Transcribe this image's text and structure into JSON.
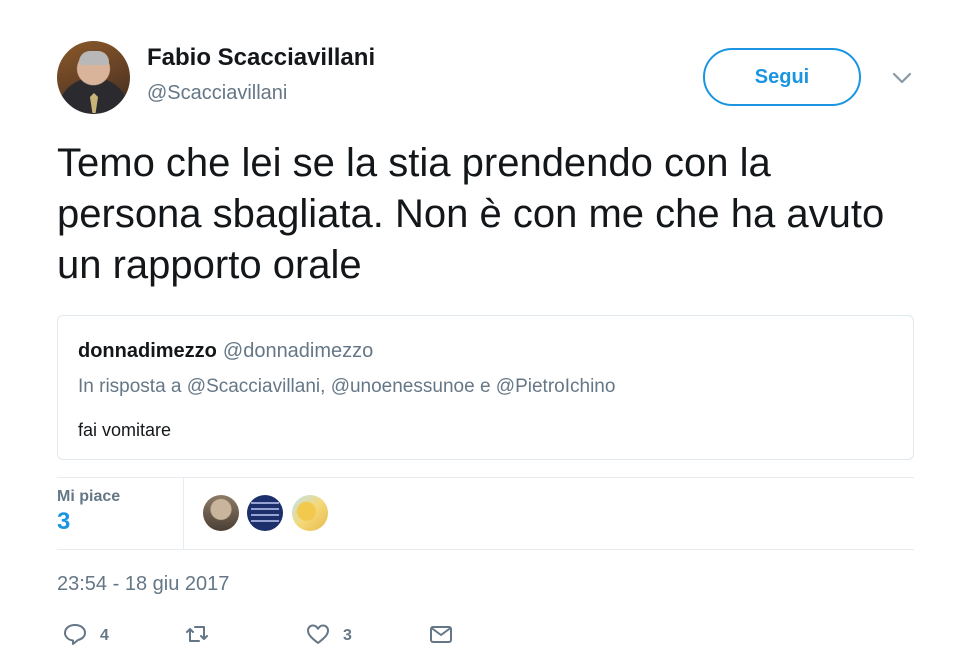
{
  "author": {
    "display_name": "Fabio Scacciavillani",
    "handle": "@Scacciavillani"
  },
  "follow_button": {
    "label": "Segui",
    "color": "#1b95e0"
  },
  "tweet": {
    "text": "Temo che lei se la stia prendendo con la persona sbagliata. Non è con me che ha avuto un rapporto orale",
    "timestamp": "23:54 - 18 giu 2017"
  },
  "quoted_tweet": {
    "name": "donnadimezzo",
    "handle": "@donnadimezzo",
    "reply_prefix": "In risposta a",
    "reply_to_1": "@Scacciavillani",
    "reply_sep_1": ",",
    "reply_to_2": "@unoenessunoe",
    "reply_sep_2": "e",
    "reply_to_3": "@PietroIchino",
    "text": "fai vomitare"
  },
  "stats": {
    "likes_label": "Mi piace",
    "likes_count": "3"
  },
  "actions": {
    "reply_count": "4",
    "retweet_count": "",
    "like_count": "3"
  },
  "icons": {
    "more": "chevron-down-icon",
    "reply": "reply-icon",
    "retweet": "retweet-icon",
    "like": "heart-icon",
    "dm": "envelope-icon"
  },
  "colors": {
    "accent": "#1b95e0",
    "secondary_text": "#657786",
    "border": "#e1e8ed"
  }
}
